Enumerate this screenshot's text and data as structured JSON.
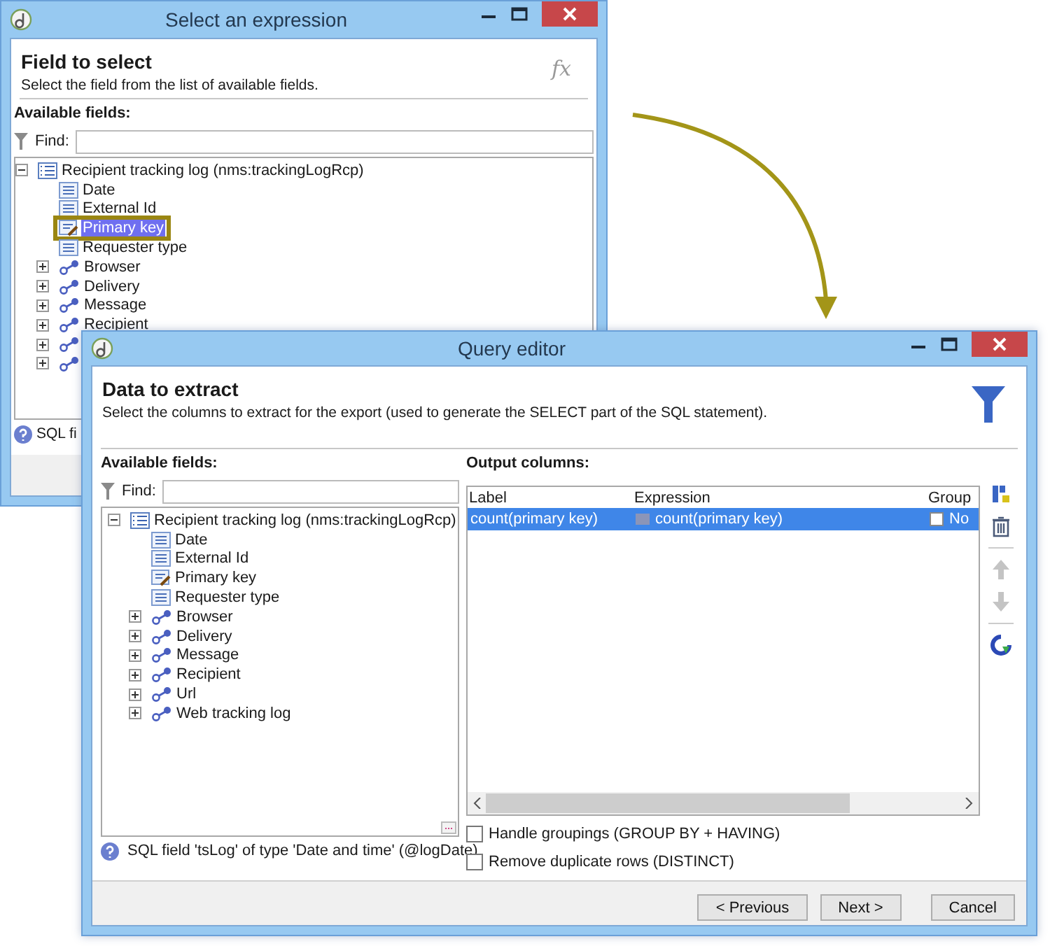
{
  "back_window": {
    "title": "Select an expression",
    "header": {
      "title": "Field to select",
      "subtitle": "Select the field from the list of available fields.",
      "icon_text": "fx"
    },
    "fields_label": "Available fields:",
    "find_label": "Find:",
    "tree": [
      {
        "kind": "table",
        "label": "Recipient tracking log (nms:trackingLogRcp)",
        "expanded": true,
        "selected": false,
        "outlined": false,
        "children": [
          {
            "kind": "field",
            "label": "Date",
            "selected": false,
            "outlined": false
          },
          {
            "kind": "field",
            "label": "External Id",
            "selected": false,
            "outlined": false
          },
          {
            "kind": "key",
            "label": "Primary key",
            "selected": true,
            "outlined": true
          },
          {
            "kind": "field",
            "label": "Requester type",
            "selected": false,
            "outlined": false
          },
          {
            "kind": "link",
            "label": "Browser",
            "expanded": false,
            "selected": false,
            "outlined": false
          },
          {
            "kind": "link",
            "label": "Delivery",
            "expanded": false,
            "selected": false,
            "outlined": false
          },
          {
            "kind": "link",
            "label": "Message",
            "expanded": false,
            "selected": false,
            "outlined": false
          },
          {
            "kind": "link",
            "label": "Recipient",
            "expanded": false,
            "selected": false,
            "outlined": false
          },
          {
            "kind": "link",
            "expanded": false,
            "outlined": false
          },
          {
            "kind": "link",
            "expanded": false,
            "outlined": false
          }
        ]
      }
    ],
    "status": "SQL fi"
  },
  "query_editor": {
    "title": "Query editor",
    "header": {
      "title": "Data to extract",
      "subtitle": "Select the columns to extract for the export (used to generate the SELECT part of the SQL statement)."
    },
    "fields_label": "Available fields:",
    "find_label": "Find:",
    "tree": [
      {
        "kind": "table",
        "label": "Recipient tracking log (nms:trackingLogRcp)",
        "expanded": true,
        "selected": false,
        "children": [
          {
            "kind": "field",
            "label": "Date",
            "selected": false
          },
          {
            "kind": "field",
            "label": "External Id",
            "selected": false
          },
          {
            "kind": "key",
            "label": "Primary key",
            "selected": false
          },
          {
            "kind": "field",
            "label": "Requester type",
            "selected": false
          },
          {
            "kind": "link",
            "label": "Browser",
            "expanded": false,
            "selected": false
          },
          {
            "kind": "link",
            "label": "Delivery",
            "expanded": false,
            "selected": false
          },
          {
            "kind": "link",
            "label": "Message",
            "expanded": false,
            "selected": false
          },
          {
            "kind": "link",
            "label": "Recipient",
            "expanded": false,
            "selected": false
          },
          {
            "kind": "link",
            "label": "Url",
            "expanded": false,
            "selected": false
          },
          {
            "kind": "link",
            "label": "Web tracking log",
            "expanded": false,
            "selected": false
          }
        ]
      }
    ],
    "status": "SQL field 'tsLog' of type 'Date and time' (@logDate)",
    "output_label": "Output columns:",
    "table": {
      "columns": [
        "Label",
        "Expression",
        "Group"
      ],
      "rows": [
        {
          "label": "count(primary key)",
          "expression": "count(primary key)",
          "group_checked": false,
          "group": "No",
          "selected": true
        }
      ]
    },
    "toolbar": [
      {
        "kind": "add",
        "disabled": false
      },
      {
        "kind": "delete",
        "disabled": false
      },
      {
        "kind": "up",
        "disabled": true
      },
      {
        "kind": "down",
        "disabled": true
      },
      {
        "kind": "refresh",
        "disabled": false
      }
    ],
    "options": [
      {
        "label": "Handle groupings (GROUP BY + HAVING)",
        "checked": false
      },
      {
        "label": "Remove duplicate rows (DISTINCT)",
        "checked": false
      }
    ],
    "buttons": [
      {
        "label": "< Previous"
      },
      {
        "label": "Next >"
      },
      {
        "label": "Cancel"
      }
    ]
  }
}
